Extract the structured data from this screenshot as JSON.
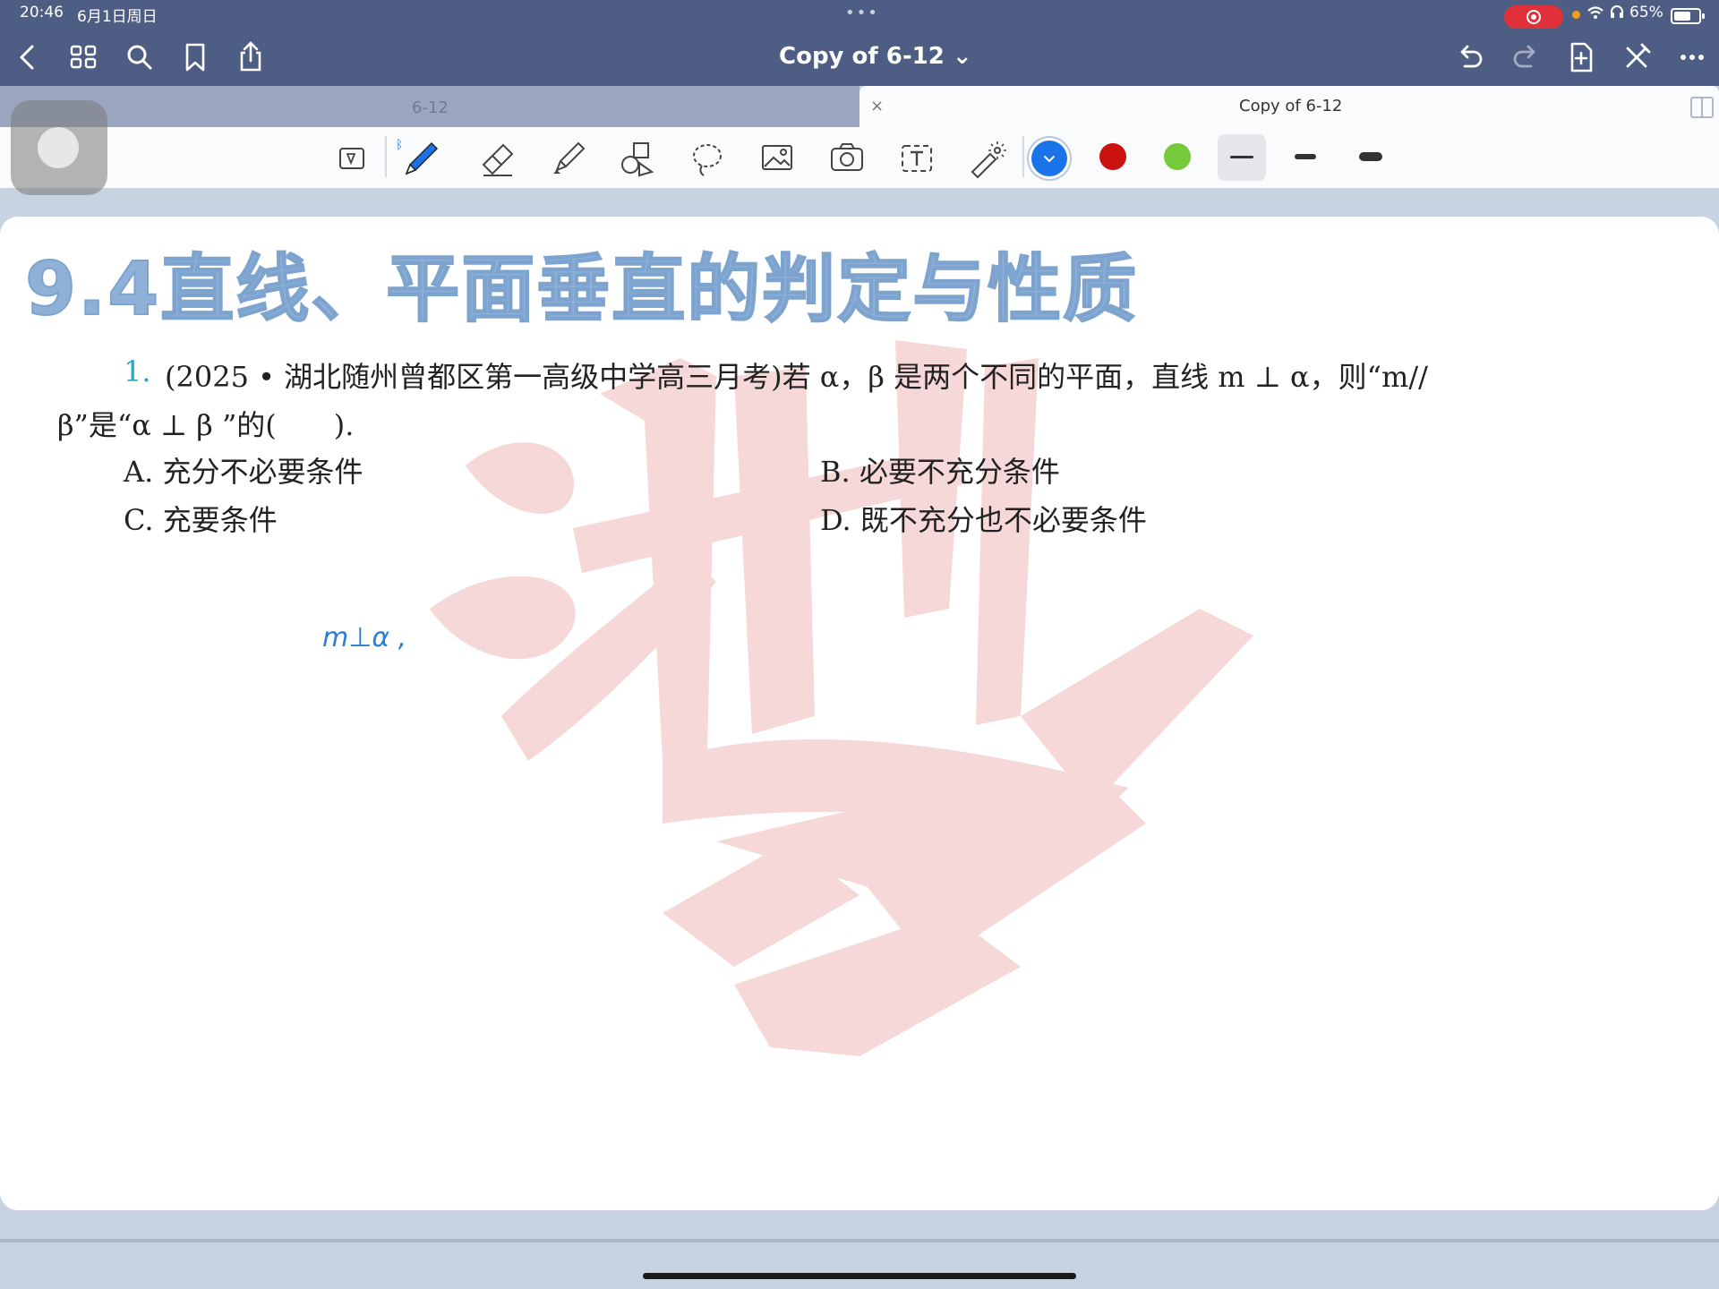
{
  "status_bar": {
    "time": "20:46",
    "date": "6月1日周日",
    "battery": "65%",
    "multitask_dots": "•••"
  },
  "nav": {
    "doc_title": "Copy of 6-12 ⌄",
    "icons": [
      "back-icon",
      "grid-icon",
      "search-icon",
      "bookmark-icon",
      "share-icon",
      "undo-icon",
      "redo-icon",
      "add-page-icon",
      "close-pen-icon",
      "more-icon"
    ]
  },
  "tabs": [
    {
      "label": "6-12",
      "active": false
    },
    {
      "label": "Copy of 6-12",
      "active": true,
      "close": "×"
    }
  ],
  "toolbar": {
    "tools": [
      "read-mode-icon",
      "pen-icon",
      "eraser-icon",
      "highlighter-icon",
      "shapes-icon",
      "lasso-icon",
      "image-icon",
      "camera-icon",
      "text-box-icon",
      "laser-pointer-icon"
    ],
    "colors": [
      "#1a73e8",
      "#cc1111",
      "#77c93c"
    ],
    "selected_color": "#1a73e8",
    "weights": [
      "thin",
      "medium",
      "thick"
    ],
    "selected_weight": "thin"
  },
  "document": {
    "heading": "9.4直线、平面垂直的判定与性质",
    "question_number": "1.",
    "question_line1": "(2025 • 湖北随州曾都区第一高级中学高三月考)若 α，β 是两个不同的平面，直线 m ⊥ α，则“m//",
    "question_line2": "β”是“α ⊥ β ”的(　　).",
    "options": {
      "A": "A.  充分不必要条件",
      "B": "B.  必要不充分条件",
      "C": "C.  充要条件",
      "D": "D.  既不充分也不必要条件"
    },
    "handwriting": "m⊥α ,",
    "heading_color": "#8fb1d8",
    "number_color": "#23a8c8",
    "ink_color": "#2a7fd4",
    "watermark_color": "#f6d6d6"
  }
}
